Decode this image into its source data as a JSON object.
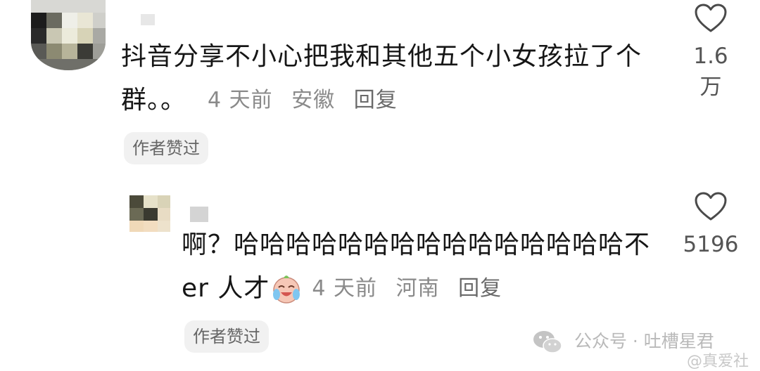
{
  "comments": [
    {
      "text_line1": "抖音分享不小心把我和其他五个小女孩拉了个",
      "text_line2": "群。。",
      "time": "4 天前",
      "location": "安徽",
      "reply": "回复",
      "likes": "1.6 万",
      "badge": "作者赞过",
      "like_icon": "heart-outline-icon"
    },
    {
      "text_line1": "啊？哈哈哈哈哈哈哈哈哈哈哈哈哈哈哈不",
      "text_line2": "er 人才",
      "emoji": "crying-laughing-emoji",
      "time": "4 天前",
      "location": "河南",
      "reply": "回复",
      "likes": "5196",
      "badge": "作者赞过",
      "like_icon": "heart-outline-icon"
    }
  ],
  "watermark": {
    "text": "公众号 · 吐槽星君",
    "icon": "wechat-icon",
    "bottom_text": "@真爱社"
  },
  "colors": {
    "text": "#161616",
    "meta": "#8a8a8a",
    "badge_bg": "#f1f1f1",
    "watermark": "#b9b9b9"
  }
}
